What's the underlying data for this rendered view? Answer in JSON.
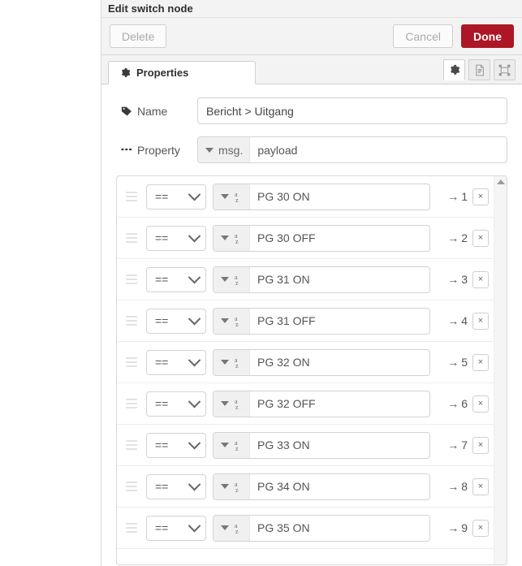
{
  "dialog": {
    "title": "Edit switch node",
    "buttons": {
      "delete": "Delete",
      "cancel": "Cancel",
      "done": "Done"
    },
    "accent_red": "#ad1625",
    "tab": {
      "label": "Properties",
      "icon": "gear-icon"
    },
    "header_icon_buttons": [
      {
        "name": "gear-icon",
        "active": true
      },
      {
        "name": "description-icon",
        "active": false
      },
      {
        "name": "appearance-icon",
        "active": false
      }
    ]
  },
  "form": {
    "name": {
      "label": "Name",
      "icon": "tag-icon",
      "value": "Bericht > Uitgang",
      "placeholder": "Name"
    },
    "property": {
      "label": "Property",
      "icon": "ellipsis-icon",
      "type_prefix": "msg.",
      "value": "payload"
    }
  },
  "rules": {
    "value_type_icon": "string-az-icon",
    "delete_label": "×",
    "arrow": "→",
    "items": [
      {
        "operator": "==",
        "value": "PG 30 ON",
        "output": "1"
      },
      {
        "operator": "==",
        "value": "PG 30 OFF",
        "output": "2"
      },
      {
        "operator": "==",
        "value": "PG 31 ON",
        "output": "3"
      },
      {
        "operator": "==",
        "value": "PG 31 OFF",
        "output": "4"
      },
      {
        "operator": "==",
        "value": "PG 32 ON",
        "output": "5"
      },
      {
        "operator": "==",
        "value": "PG 32 OFF",
        "output": "6"
      },
      {
        "operator": "==",
        "value": "PG 33 ON",
        "output": "7"
      },
      {
        "operator": "==",
        "value": "PG 34 ON",
        "output": "8"
      },
      {
        "operator": "==",
        "value": "PG 35 ON",
        "output": "9"
      }
    ]
  },
  "scrollbar": {
    "up_arrow": "scroll-up-arrow"
  }
}
